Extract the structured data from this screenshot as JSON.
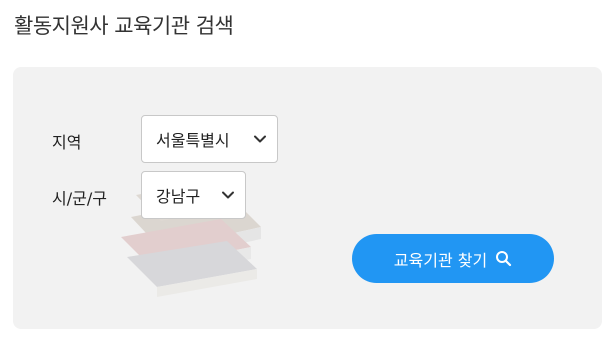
{
  "header": {
    "title": "활동지원사 교육기관 검색"
  },
  "form": {
    "region_label": "지역",
    "region_value": "서울특별시",
    "district_label": "시/군/구",
    "district_value": "강남구",
    "search_button_label": "교육기관 찾기"
  },
  "icons": {
    "region_dropdown": "chevron-down-icon",
    "district_dropdown": "chevron-down-icon",
    "search": "search-icon",
    "background": "books-illustration"
  },
  "colors": {
    "accent": "#2196f3",
    "panel_background": "#f2f2f2",
    "title_text": "#333333"
  }
}
